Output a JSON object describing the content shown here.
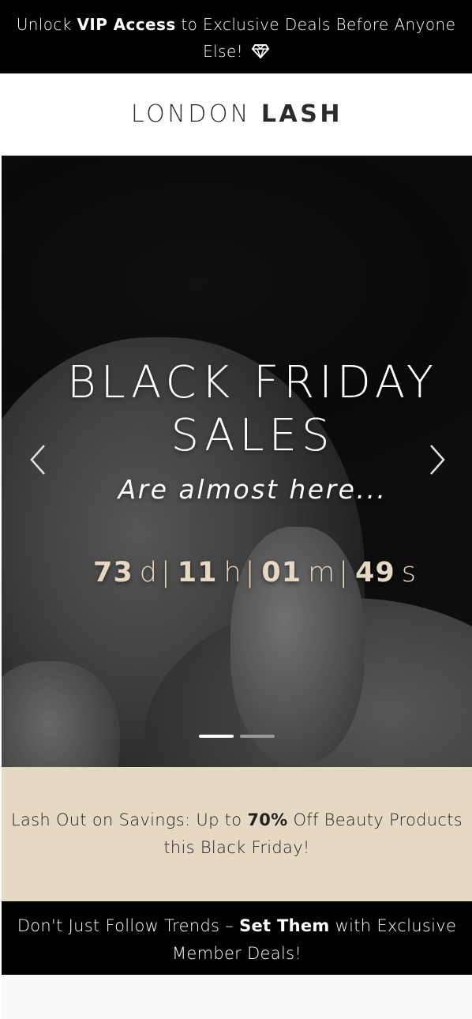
{
  "announcement": {
    "prefix": "Unlock ",
    "highlight": "VIP Access",
    "suffix": " to Exclusive Deals Before Anyone Else!",
    "icon": "diamond-icon"
  },
  "header": {
    "logo_light": "LONDON ",
    "logo_bold": "LASH"
  },
  "hero": {
    "title_line1": "BLACK FRIDAY",
    "title_line2": "SALES",
    "subtitle": "Are almost here...",
    "prev_icon": "chevron-left-icon",
    "next_icon": "chevron-right-icon",
    "countdown": {
      "days": "73",
      "days_unit": "d",
      "hours": "11",
      "hours_unit": "h",
      "minutes": "01",
      "minutes_unit": "m",
      "seconds": "49",
      "seconds_unit": "s",
      "separator": "|"
    },
    "slides": {
      "total": 2,
      "active": 1
    }
  },
  "promo": {
    "prefix": "Lash Out on Savings: Up to ",
    "highlight": "70%",
    "suffix": " Off Beauty Products this Black Friday!"
  },
  "member": {
    "prefix": "Don't Just Follow Trends – ",
    "highlight": "Set Them",
    "suffix": " with Exclusive Member Deals!"
  },
  "colors": {
    "announcement_bg": "#000000",
    "promo_bg": "#e6d9c3",
    "countdown_text": "#e6d8c3",
    "member_bg": "#000000"
  }
}
